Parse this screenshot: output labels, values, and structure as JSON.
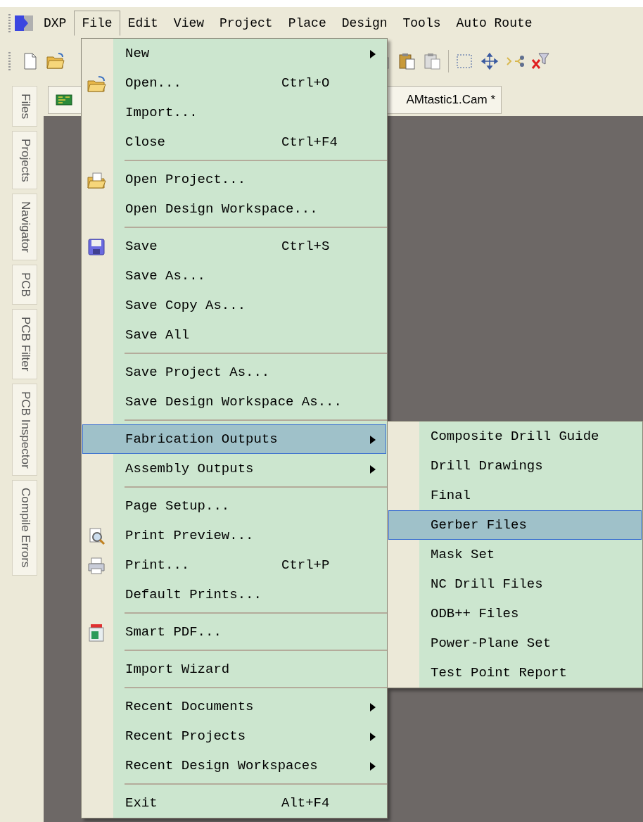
{
  "menubar": [
    {
      "label": "DXP",
      "selected": false
    },
    {
      "label": "File",
      "selected": true
    },
    {
      "label": "Edit",
      "selected": false
    },
    {
      "label": "View",
      "selected": false
    },
    {
      "label": "Project",
      "selected": false
    },
    {
      "label": "Place",
      "selected": false
    },
    {
      "label": "Design",
      "selected": false
    },
    {
      "label": "Tools",
      "selected": false
    },
    {
      "label": "Auto Route",
      "selected": false
    }
  ],
  "side_panels": [
    {
      "label": "Files"
    },
    {
      "label": "Projects"
    },
    {
      "label": "Navigator"
    },
    {
      "label": "PCB"
    },
    {
      "label": "PCB Filter"
    },
    {
      "label": "PCB Inspector"
    },
    {
      "label": "Compile Errors"
    }
  ],
  "document_tab": {
    "label": "AMtastic1.Cam *"
  },
  "file_menu": {
    "items": [
      {
        "kind": "item",
        "label": "New",
        "submenu": true,
        "icon": false,
        "selected": false
      },
      {
        "kind": "item",
        "label": "Open...",
        "shortcut": "Ctrl+O",
        "submenu": false,
        "icon": true,
        "selected": false
      },
      {
        "kind": "item",
        "label": "Import...",
        "submenu": false,
        "icon": false,
        "selected": false
      },
      {
        "kind": "item",
        "label": "Close",
        "shortcut": "Ctrl+F4",
        "submenu": false,
        "icon": false,
        "selected": false
      },
      {
        "kind": "separator"
      },
      {
        "kind": "item",
        "label": "Open Project...",
        "submenu": false,
        "icon": true,
        "selected": false
      },
      {
        "kind": "item",
        "label": "Open Design Workspace...",
        "submenu": false,
        "icon": false,
        "selected": false
      },
      {
        "kind": "separator"
      },
      {
        "kind": "item",
        "label": "Save",
        "shortcut": "Ctrl+S",
        "submenu": false,
        "icon": true,
        "selected": false
      },
      {
        "kind": "item",
        "label": "Save As...",
        "submenu": false,
        "icon": false,
        "selected": false
      },
      {
        "kind": "item",
        "label": "Save Copy As...",
        "submenu": false,
        "icon": false,
        "selected": false
      },
      {
        "kind": "item",
        "label": "Save All",
        "submenu": false,
        "icon": false,
        "selected": false
      },
      {
        "kind": "separator"
      },
      {
        "kind": "item",
        "label": "Save Project As...",
        "submenu": false,
        "icon": false,
        "selected": false
      },
      {
        "kind": "item",
        "label": "Save Design Workspace As...",
        "submenu": false,
        "icon": false,
        "selected": false
      },
      {
        "kind": "separator"
      },
      {
        "kind": "item",
        "label": "Fabrication Outputs",
        "submenu": true,
        "icon": false,
        "selected": true
      },
      {
        "kind": "item",
        "label": "Assembly Outputs",
        "submenu": true,
        "icon": false,
        "selected": false
      },
      {
        "kind": "separator"
      },
      {
        "kind": "item",
        "label": "Page Setup...",
        "submenu": false,
        "icon": false,
        "selected": false
      },
      {
        "kind": "item",
        "label": "Print Preview...",
        "submenu": false,
        "icon": true,
        "selected": false
      },
      {
        "kind": "item",
        "label": "Print...",
        "shortcut": "Ctrl+P",
        "submenu": false,
        "icon": true,
        "selected": false
      },
      {
        "kind": "item",
        "label": "Default Prints...",
        "submenu": false,
        "icon": false,
        "selected": false
      },
      {
        "kind": "separator"
      },
      {
        "kind": "item",
        "label": "Smart PDF...",
        "submenu": false,
        "icon": true,
        "selected": false
      },
      {
        "kind": "separator"
      },
      {
        "kind": "item",
        "label": "Import Wizard",
        "submenu": false,
        "icon": false,
        "selected": false
      },
      {
        "kind": "separator"
      },
      {
        "kind": "item",
        "label": "Recent Documents",
        "submenu": true,
        "icon": false,
        "selected": false
      },
      {
        "kind": "item",
        "label": "Recent Projects",
        "submenu": true,
        "icon": false,
        "selected": false
      },
      {
        "kind": "item",
        "label": "Recent Design Workspaces",
        "submenu": true,
        "icon": false,
        "selected": false
      },
      {
        "kind": "separator"
      },
      {
        "kind": "item",
        "label": "Exit",
        "shortcut": "Alt+F4",
        "submenu": false,
        "icon": false,
        "selected": false
      }
    ]
  },
  "fabrication_submenu": {
    "items": [
      {
        "label": "Composite Drill Guide",
        "selected": false
      },
      {
        "label": "Drill Drawings",
        "selected": false
      },
      {
        "label": "Final",
        "selected": false
      },
      {
        "label": "Gerber Files",
        "selected": true
      },
      {
        "label": "Mask Set",
        "selected": false
      },
      {
        "label": "NC Drill Files",
        "selected": false
      },
      {
        "label": "ODB++ Files",
        "selected": false
      },
      {
        "label": "Power-Plane Set",
        "selected": false
      },
      {
        "label": "Test Point Report",
        "selected": false
      }
    ]
  }
}
